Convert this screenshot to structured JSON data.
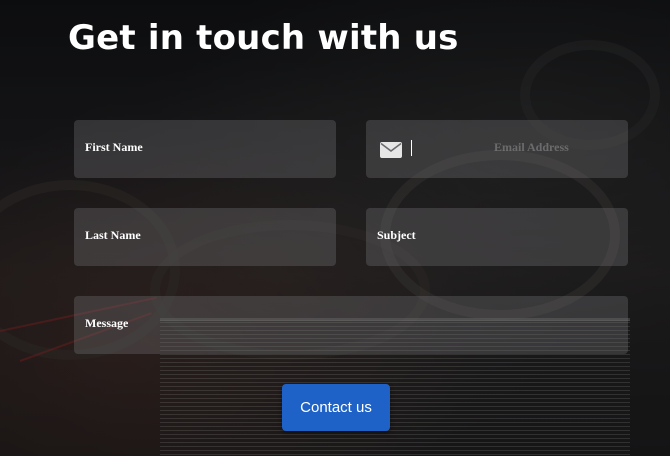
{
  "heading": "Get in touch with us",
  "form": {
    "first_name_label": "First Name",
    "email_placeholder": "Email Address",
    "last_name_label": "Last Name",
    "subject_label": "Subject",
    "message_label": "Message",
    "submit_label": "Contact us",
    "email_icon": "envelope-icon"
  },
  "colors": {
    "button": "#1e62c7",
    "field_bg": "rgba(120,120,124,0.32)",
    "text": "#ffffff"
  }
}
